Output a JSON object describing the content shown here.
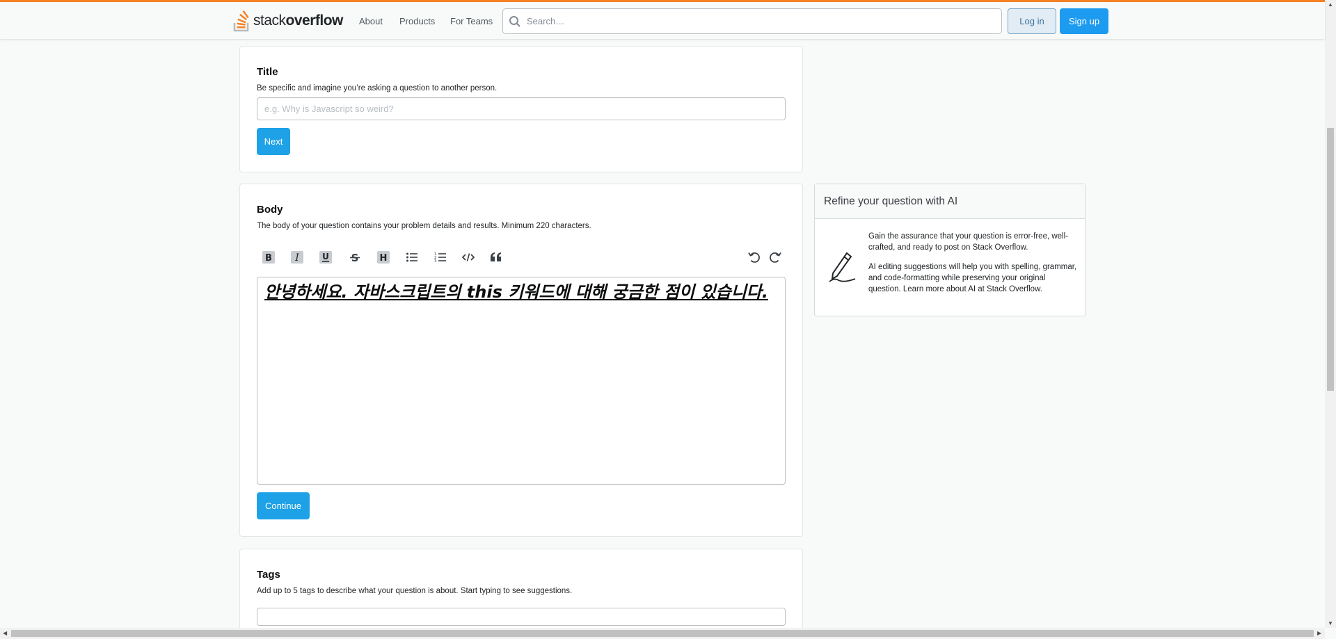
{
  "header": {
    "logo_light": "stack",
    "logo_bold": "overflow",
    "nav": [
      "About",
      "Products",
      "For Teams"
    ],
    "search_placeholder": "Search…",
    "login_label": "Log in",
    "signup_label": "Sign up",
    "accent_color": "#f48225"
  },
  "title_card": {
    "heading": "Title",
    "description": "Be specific and imagine you’re asking a question to another person.",
    "input_value": "",
    "input_placeholder": "e.g. Why is Javascript so weird?",
    "next_label": "Next"
  },
  "body_card": {
    "heading": "Body",
    "description": "The body of your question contains your problem details and results. Minimum 220 characters.",
    "toolbar": [
      "bold-icon",
      "italic-icon",
      "underline-icon",
      "strikethrough-icon",
      "heading-icon",
      "bulleted-list-icon",
      "numbered-list-icon",
      "code-icon",
      "quote-icon",
      "undo-icon",
      "redo-icon"
    ],
    "editor_text_before": "안녕하세요. 자바스크립트의 ",
    "editor_text_keyword": "this",
    "editor_text_after": " 키워드에 대해 궁금한 점이 있습니다.",
    "continue_label": "Continue"
  },
  "tags_card": {
    "heading": "Tags",
    "description": "Add up to 5 tags to describe what your question is about. Start typing to see suggestions.",
    "input_value": ""
  },
  "ai_card": {
    "heading": "Refine your question with AI",
    "paragraph1": "Gain the assurance that your question is error-free, well-crafted, and ready to post on Stack Overflow.",
    "paragraph2": "AI editing suggestions will help you with spelling, grammar, and code-formatting while preserving your original question. Learn more about AI at Stack Overflow.",
    "icon": "pencil-icon"
  }
}
